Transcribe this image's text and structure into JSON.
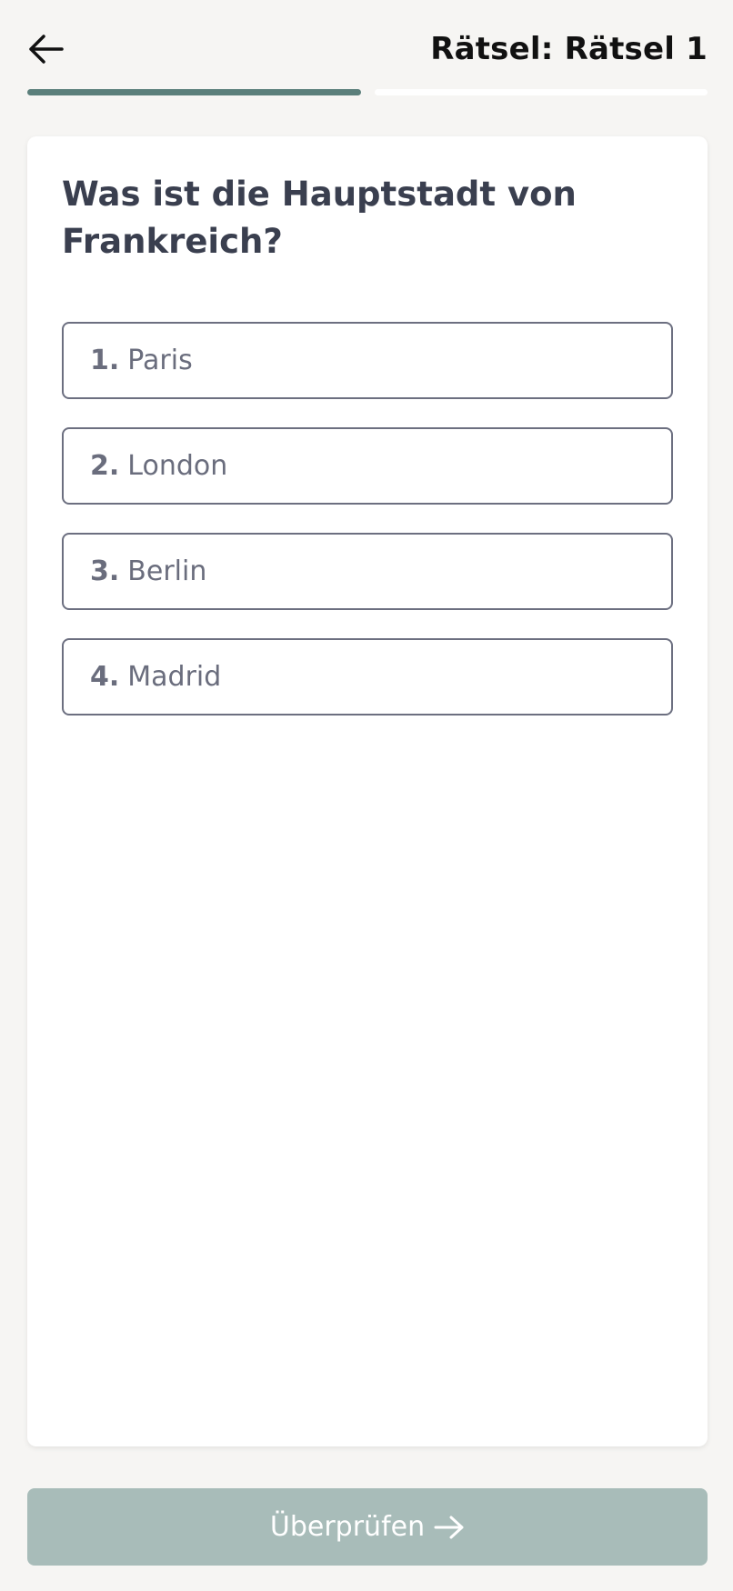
{
  "header": {
    "title": "Rätsel: Rätsel 1",
    "back_icon": "arrow-left-icon"
  },
  "progress": {
    "total_steps": 2,
    "current_step": 1,
    "active_color": "#5b7f7b",
    "inactive_color": "#ffffff"
  },
  "quiz": {
    "question": "Was ist die Hauptstadt von Frankreich?",
    "options": [
      {
        "number": "1.",
        "label": "Paris"
      },
      {
        "number": "2.",
        "label": "London"
      },
      {
        "number": "3.",
        "label": "Berlin"
      },
      {
        "number": "4.",
        "label": "Madrid"
      }
    ]
  },
  "footer": {
    "submit_label": "Überprüfen",
    "submit_icon": "arrow-right-icon",
    "submit_color": "#a8bcb9"
  }
}
